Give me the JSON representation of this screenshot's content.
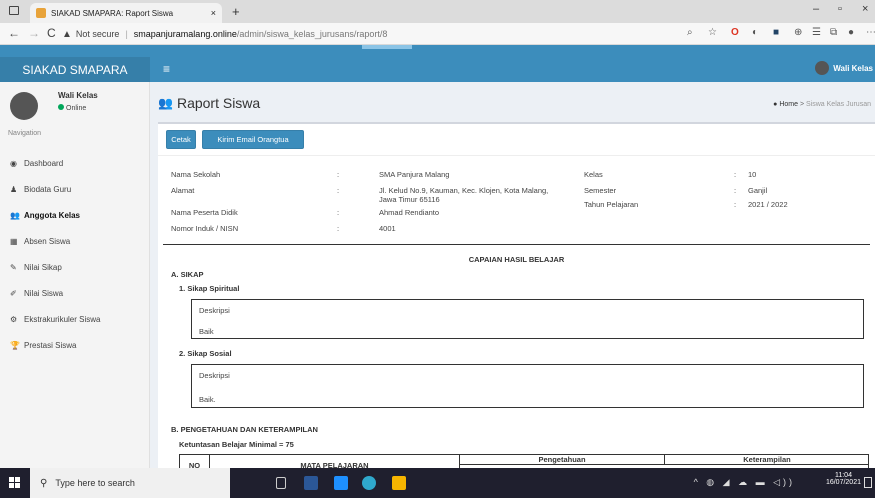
{
  "browser": {
    "tab_title": "SIAKAD SMAPARA: Raport Siswa",
    "tab_close": "×",
    "new_tab": "+",
    "security": "Not secure",
    "url_host": "smapanjuramalang.online",
    "url_path": "/admin/siswa_kelas_jurusans/raport/8",
    "back": "←",
    "forward": "→",
    "refresh": "C",
    "minimize": "–",
    "maximize": "▫",
    "close": "×"
  },
  "app": {
    "brand": "SIAKAD SMAPARA",
    "menu_toggle": "≡",
    "top_user": "Wali Kelas"
  },
  "sidebar": {
    "user_name": "Wali Kelas",
    "status": "Online",
    "nav_header": "Navigation",
    "items": [
      {
        "label": "Dashboard",
        "icon": "dashboard-icon",
        "glyph": "◉"
      },
      {
        "label": "Biodata Guru",
        "icon": "user-icon",
        "glyph": "♟"
      },
      {
        "label": "Anggota Kelas",
        "icon": "users-icon",
        "glyph": "👥"
      },
      {
        "label": "Absen Siswa",
        "icon": "table-icon",
        "glyph": "▦"
      },
      {
        "label": "Nilai Sikap",
        "icon": "edit-icon",
        "glyph": "✎"
      },
      {
        "label": "Nilai Siswa",
        "icon": "pencil-icon",
        "glyph": "✐"
      },
      {
        "label": "Ekstrakurikuler Siswa",
        "icon": "extracurricular-icon",
        "glyph": "⚙"
      },
      {
        "label": "Prestasi Siswa",
        "icon": "trophy-icon",
        "glyph": "🏆"
      }
    ]
  },
  "page": {
    "title": "Raport Siswa",
    "breadcrumb_home": "Home",
    "breadcrumb_sep": ">",
    "breadcrumb_current": "Siswa Kelas Jurusan",
    "btn_print": "Cetak",
    "btn_email": "Kirim Email Orangtua"
  },
  "info_left": [
    {
      "label": "Nama Sekolah",
      "value": "SMA Panjura Malang"
    },
    {
      "label": "Alamat",
      "value": "Jl. Kelud No.9, Kauman, Kec. Klojen, Kota Malang,",
      "value2": "Jawa Timur 65116"
    },
    {
      "label": "Nama Peserta Didik",
      "value": "Ahmad Rendianto"
    },
    {
      "label": "Nomor Induk / NISN",
      "value": "4001"
    }
  ],
  "info_right": [
    {
      "label": "Kelas",
      "value": "10"
    },
    {
      "label": "Semester",
      "value": "Ganjil"
    },
    {
      "label": "Tahun Pelajaran",
      "value": "2021 / 2022"
    }
  ],
  "colon": ":",
  "report": {
    "heading": "CAPAIAN HASIL BELAJAR",
    "section_a": "A. SIKAP",
    "spiritual_title": "1. Sikap Spiritual",
    "spiritual_label": "Deskripsi",
    "spiritual_value": "Baik",
    "sosial_title": "2. Sikap Sosial",
    "sosial_label": "Deskripsi",
    "sosial_value": "Baik.",
    "section_b": "B. PENGETAHUAN DAN KETERAMPILAN",
    "kbm": "Ketuntasan Belajar Minimal = 75",
    "col_no": "NO",
    "col_mapel": "MATA PELAJARAN",
    "col_pengetahuan": "Pengetahuan",
    "col_keterampilan": "Keterampilan"
  },
  "taskbar": {
    "search_placeholder": "Type here to search",
    "time": "11:04",
    "date": "16/07/2021"
  }
}
